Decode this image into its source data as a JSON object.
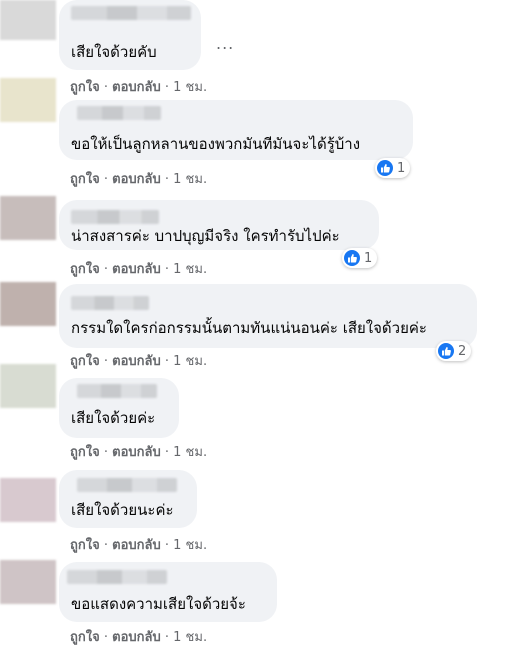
{
  "comments": [
    {
      "text": "เสียใจด้วยคับ",
      "time": "1 ชม.",
      "reactions": null
    },
    {
      "text": "ขอให้เป็นลูกหลานของพวกมันทีมันจะได้รู้บ้าง",
      "time": "1 ชม.",
      "reactions": "1"
    },
    {
      "text": "น่าสงสารค่ะ บาปบุญมีจริง ใครทำรับไปค่ะ",
      "time": "1 ชม.",
      "reactions": "1"
    },
    {
      "text": "กรรมใดใครก่อกรรมนั้นตามทันแน่นอนค่ะ เสียใจด้วยค่ะ",
      "time": "1 ชม.",
      "reactions": "2"
    },
    {
      "text": "เสียใจด้วยค่ะ",
      "time": "1 ชม.",
      "reactions": null
    },
    {
      "text": "เสียใจด้วยนะค่ะ",
      "time": "1 ชม.",
      "reactions": null
    },
    {
      "text": "ขอแสดงความเสียใจด้วยจ้ะ",
      "time": "1 ชม.",
      "reactions": null
    }
  ],
  "actions": {
    "like": "ถูกใจ",
    "reply": "ตอบกลับ",
    "separator": "·"
  },
  "more_icon": "...",
  "colors": {
    "bubble": "#f0f2f5",
    "meta": "#65676b",
    "like": "#1877f2"
  }
}
